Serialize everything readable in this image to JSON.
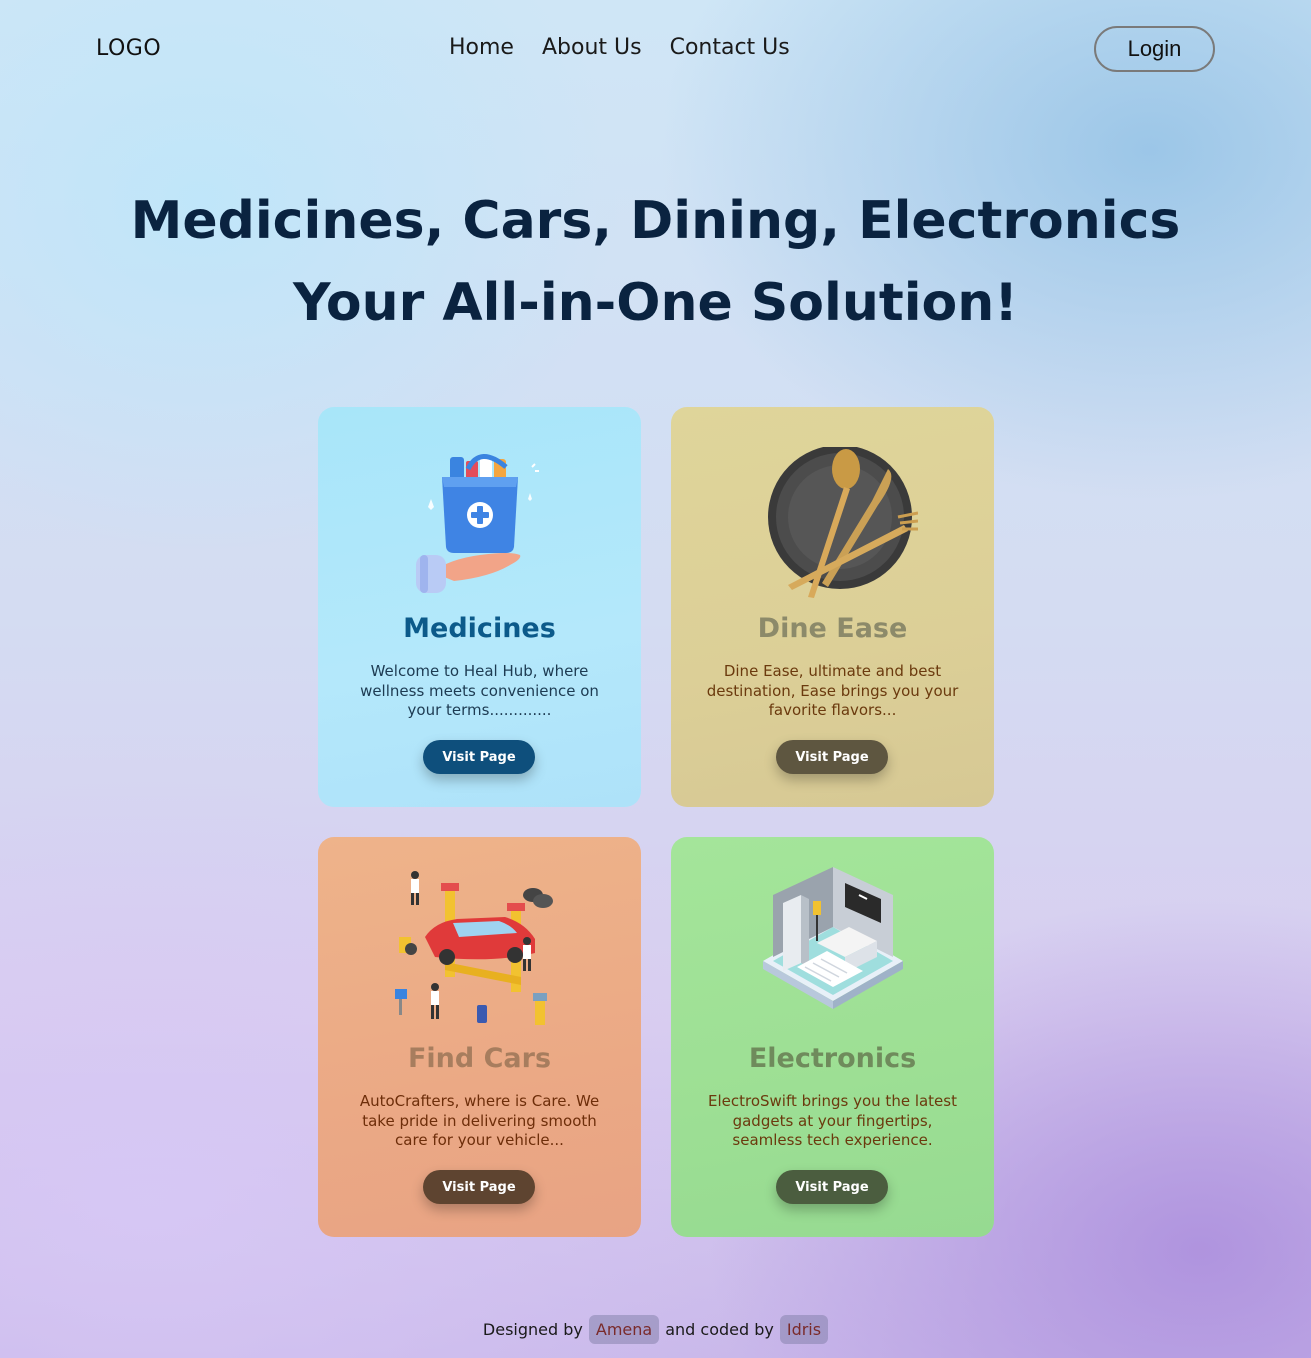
{
  "nav": {
    "logo": "LOGO",
    "links": [
      "Home",
      "About Us",
      "Contact Us"
    ],
    "login": "Login"
  },
  "hero": {
    "line1": "Medicines, Cars, Dining, Electronics",
    "line2": "Your All-in-One Solution!"
  },
  "cards": [
    {
      "title": "Medicines",
      "description": "Welcome to Heal Hub, where wellness meets convenience on your terms.............",
      "button": "Visit Page",
      "icon": "medicine-bag-icon",
      "accent": "#0e4f7c"
    },
    {
      "title": "Dine Ease",
      "description": "Dine Ease, ultimate and best destination, Ease brings you your favorite flavors...",
      "button": "Visit Page",
      "icon": "plate-cutlery-icon",
      "accent": "#5e5640"
    },
    {
      "title": "Find Cars",
      "description": "AutoCrafters, where is Care. We take pride in delivering smooth care for your vehicle...",
      "button": "Visit Page",
      "icon": "car-service-icon",
      "accent": "#5e4430"
    },
    {
      "title": "Electronics",
      "description": "ElectroSwift brings you the latest gadgets at your fingertips, seamless tech experience.",
      "button": "Visit Page",
      "icon": "smart-home-icon",
      "accent": "#4b5d3f"
    }
  ],
  "footer": {
    "designed_by_label": "Designed by",
    "designer": "Amena",
    "coded_by_label": "and coded by",
    "coder": "Idris"
  }
}
